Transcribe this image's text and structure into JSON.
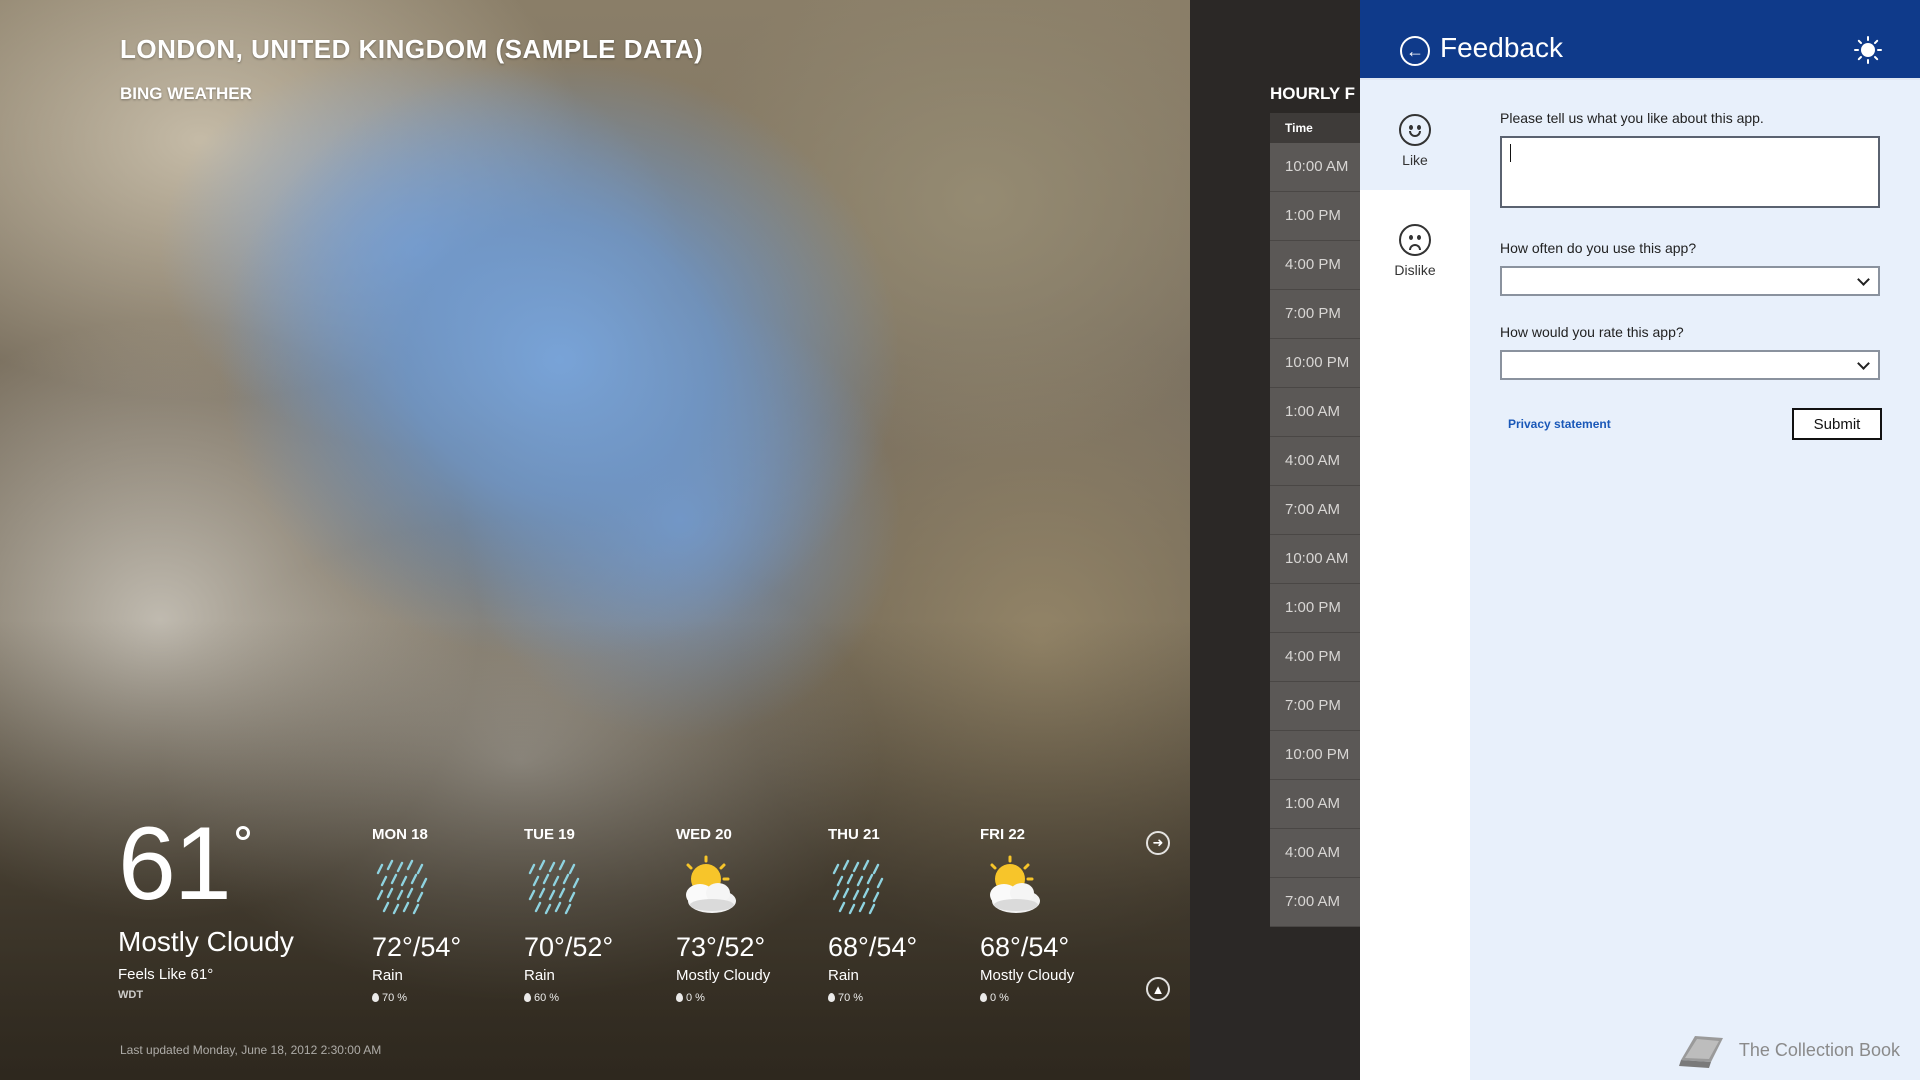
{
  "weather": {
    "location": "LONDON, UNITED KINGDOM (SAMPLE DATA)",
    "brand": "BING WEATHER",
    "current": {
      "temp": "61",
      "condition": "Mostly Cloudy",
      "feels_like": "Feels Like 61°",
      "station": "WDT"
    },
    "forecast": [
      {
        "day": "MON 18",
        "temps": "72°/54°",
        "condition": "Rain",
        "precip": "70 %",
        "icon": "rain-icon"
      },
      {
        "day": "TUE 19",
        "temps": "70°/52°",
        "condition": "Rain",
        "precip": "60 %",
        "icon": "rain-icon"
      },
      {
        "day": "WED 20",
        "temps": "73°/52°",
        "condition": "Mostly Cloudy",
        "precip": "0 %",
        "icon": "partly-cloudy-icon"
      },
      {
        "day": "THU 21",
        "temps": "68°/54°",
        "condition": "Rain",
        "precip": "70 %",
        "icon": "rain-icon"
      },
      {
        "day": "FRI 22",
        "temps": "68°/54°",
        "condition": "Mostly Cloudy",
        "precip": "0 %",
        "icon": "partly-cloudy-icon"
      }
    ],
    "last_updated": "Last updated Monday, June 18, 2012 2:30:00 AM"
  },
  "hourly": {
    "title": "HOURLY F",
    "header": "Time",
    "times": [
      "10:00 AM",
      "1:00 PM",
      "4:00 PM",
      "7:00 PM",
      "10:00 PM",
      "1:00 AM",
      "4:00 AM",
      "7:00 AM",
      "10:00 AM",
      "1:00 PM",
      "4:00 PM",
      "7:00 PM",
      "10:00 PM",
      "1:00 AM",
      "4:00 AM",
      "7:00 AM"
    ]
  },
  "feedback": {
    "title": "Feedback",
    "tabs": {
      "like": "Like",
      "dislike": "Dislike"
    },
    "prompt_like": "Please tell us what you like about this app.",
    "comment_value": "",
    "q_frequency": "How often do you use this app?",
    "frequency_value": "",
    "q_rating": "How would you rate this app?",
    "rating_value": "",
    "privacy_link": "Privacy statement",
    "submit_label": "Submit"
  },
  "watermark": "The Collection Book",
  "colors": {
    "header_blue": "#0f3a8a",
    "pane_bg": "#e8f0fb",
    "link_blue": "#1a58b8",
    "hourly_row": "#5b5856"
  }
}
